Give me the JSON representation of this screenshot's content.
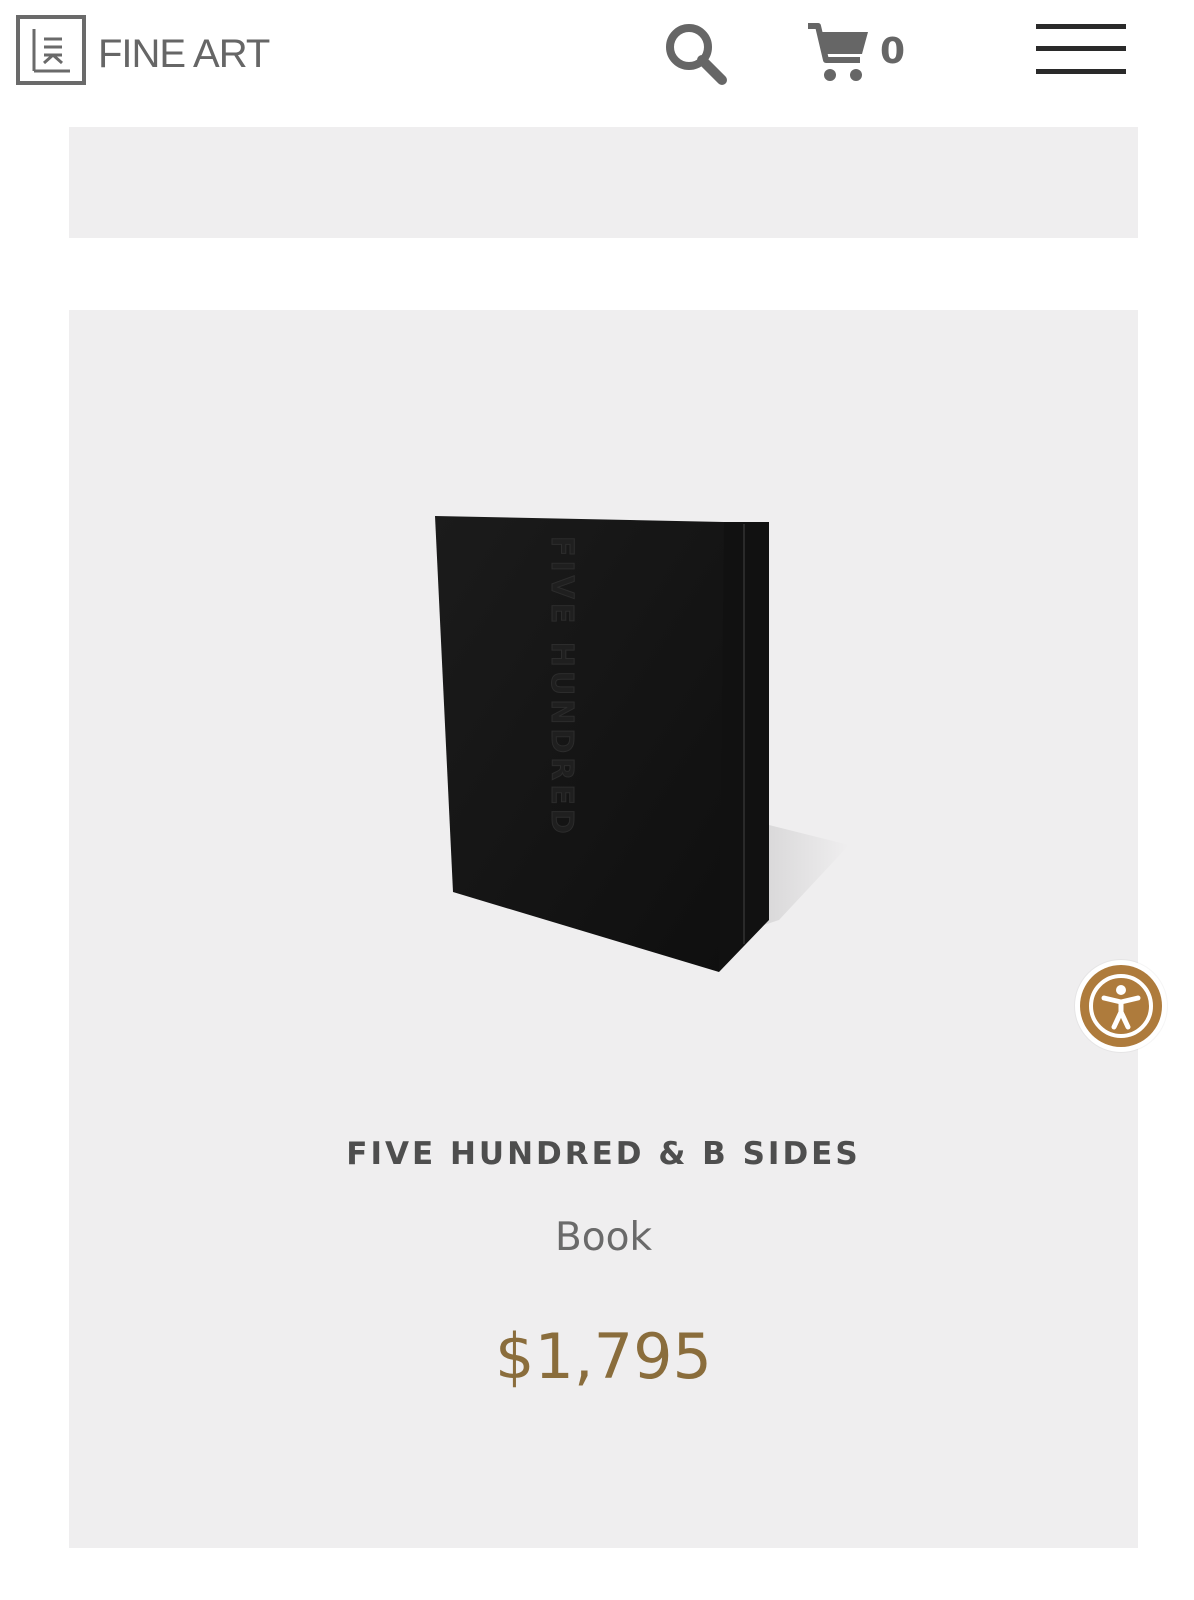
{
  "header": {
    "brand_name": "FINE ART",
    "logo_icon": "lik-logo-icon",
    "search_icon": "search-icon",
    "cart_icon": "cart-icon",
    "cart_count": "0",
    "menu_icon": "hamburger-menu-icon"
  },
  "product": {
    "title": "FIVE HUNDRED & B SIDES",
    "type": "Book",
    "price": "$1,795",
    "price_color": "#8a6d3c",
    "image_spine_text": "FIVE HUNDRED"
  },
  "accessibility": {
    "icon": "accessibility-person-icon",
    "color": "#ae7b3c"
  }
}
